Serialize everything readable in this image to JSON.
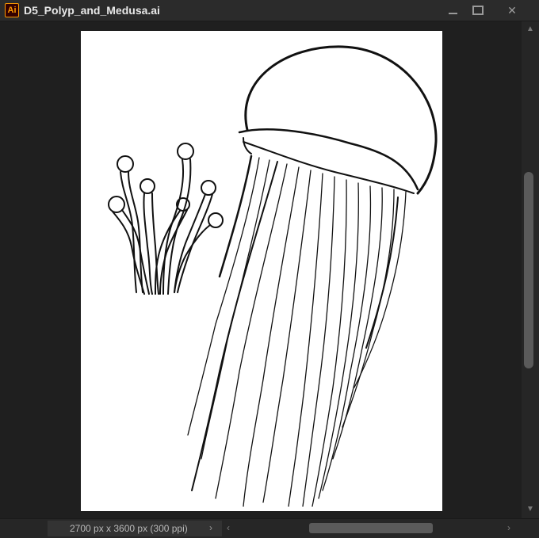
{
  "app": {
    "icon_label": "Ai"
  },
  "document": {
    "title": "D5_Polyp_and_Medusa.ai"
  },
  "window_controls": {
    "minimize": "minimize",
    "maximize": "maximize",
    "close": "✕"
  },
  "status": {
    "dimensions": "2700 px x 3600 px (300 ppi)",
    "menu_chevron": "›"
  },
  "scroll": {
    "up": "▲",
    "down": "▼",
    "left": "‹",
    "right": "›"
  },
  "colors": {
    "accent": "#ff9a00",
    "chrome": "#2b2b2b",
    "canvas": "#1f1f1f",
    "artboard": "#ffffff"
  },
  "artboard_content": {
    "subjects": [
      "polyp",
      "medusa"
    ]
  }
}
